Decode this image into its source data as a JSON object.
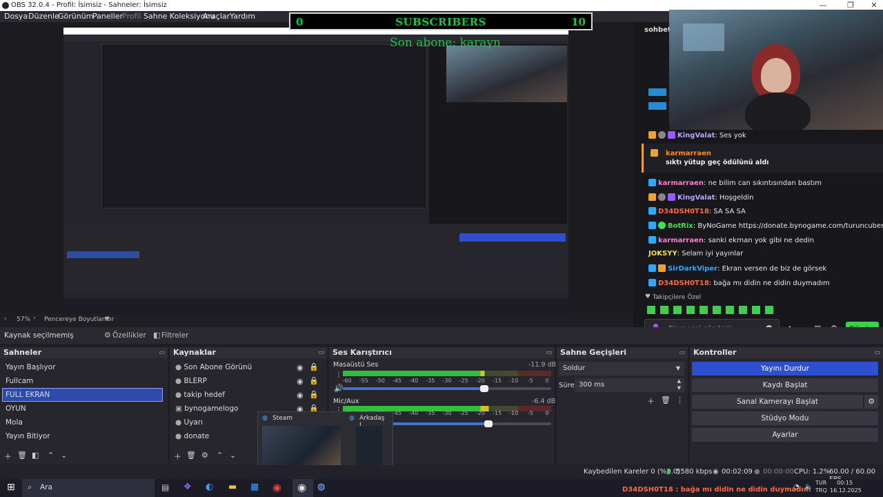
{
  "titlebar": {
    "title": "OBS 32.0.4 - Profil: İsimsiz - Sahneler: İsimsiz",
    "minimize": "—",
    "maximize": "❐",
    "close": "✕"
  },
  "menu": {
    "items": [
      "Dosya",
      "Düzenle",
      "Görünüm",
      "Paneller",
      "Profil",
      "Sahne Koleksiyonu",
      "Araçlar",
      "Yardım"
    ]
  },
  "overlay": {
    "subs_count": "0",
    "subs_title": "SUBSCRIBERS",
    "subs_goal": "10",
    "last_sub": "Son abone: karayn"
  },
  "preview_bar": {
    "zoom": "57%",
    "fit_label": "Pencereye Boyutlandır"
  },
  "source_bar": {
    "status": "Kaynak seçilmemiş",
    "properties": "Özellikler",
    "filters": "Filtreler"
  },
  "scenes": {
    "title": "Sahneler",
    "items": [
      "Yayın Başlıyor",
      "Fullcam",
      "FULL EKRAN",
      "OYUN",
      "Mola",
      "Yayın Bitiyor"
    ],
    "selected_index": 2
  },
  "sources": {
    "title": "Kaynaklar",
    "items": [
      "Son Abone Görünü",
      "BLERP",
      "takip hedef",
      "bynogamelogo",
      "Uyarı",
      "donate"
    ]
  },
  "mixer": {
    "title": "Ses Karıştırıcı",
    "channels": [
      {
        "name": "Masaüstü Ses",
        "db": "-11.9 dB",
        "level": 0.68
      },
      {
        "name": "Mic/Aux",
        "db": "-6.4 dB",
        "level": 0.7
      }
    ],
    "ticks": [
      "-60",
      "-55",
      "-50",
      "-45",
      "-40",
      "-35",
      "-30",
      "-25",
      "-20",
      "-15",
      "-10",
      "-5",
      "0"
    ]
  },
  "transitions": {
    "title": "Sahne Geçişleri",
    "selected": "Soldur",
    "duration_label": "Süre",
    "duration": "300 ms"
  },
  "controls": {
    "title": "Kontroller",
    "buttons": [
      "Yayını Durdur",
      "Kaydı Başlat",
      "Sanal Kamerayı Başlat",
      "Stüdyo Modu",
      "Ayarlar"
    ]
  },
  "chat": {
    "header": "sohbet",
    "messages": [
      {
        "user": "KingValat",
        "text": "Ses yok",
        "color": "#b8a6ff"
      },
      {
        "user": "karmarraen",
        "text": "sıktı yütup geç ödülünü aldı",
        "color": "#ff8c1a"
      },
      {
        "user": "karmarraen",
        "text": "ne bilim can sıkıntısından bastım",
        "color": "#ff7ad4"
      },
      {
        "user": "KingValat",
        "text": "Hoşgeldin",
        "color": "#b8a6ff"
      },
      {
        "user": "D34DSH0T18",
        "text": "SA SA SA",
        "color": "#ff6a3d"
      },
      {
        "user": "BotRix",
        "text": "ByNoGame https://donate.bynogame.com/turuncubenim",
        "color": "#44dd55"
      },
      {
        "user": "karmarraen",
        "text": "sanki ekrnan yok gibi ne dedin",
        "color": "#ff7ad4"
      },
      {
        "user": "JOKSYY",
        "text": "Selam iyi yayınlar",
        "color": "#f0e040"
      },
      {
        "user": "SirDarkViper",
        "text": "Ekran versen de biz de görsek",
        "color": "#2ea8ff"
      },
      {
        "user": "D34DSH0T18",
        "text": "bağa mı didin ne didin duymadım",
        "color": "#ff6a3d"
      }
    ],
    "emote_label": "Takipçilere Özel",
    "input_placeholder": "Bir mesaj gönderin",
    "send": "Gönder"
  },
  "status": {
    "dropped": "Kaybedilen Kareler 0 (%0.0)",
    "bitrate": "5580 kbps",
    "live_time": "00:02:09",
    "rec_time": "00:00:00",
    "cpu": "CPU: 1.2%",
    "fps": "60.00 / 60.00 FPS"
  },
  "taskbar": {
    "search": "Ara",
    "lang1": "TUR",
    "lang2": "TRQ",
    "time": "00:15",
    "date": "16.12.2025",
    "ticker": "D34DSH0T18 : bağa mı didin ne didin duymadım"
  },
  "popup": {
    "app1": "Steam",
    "app2": "Arkadaş L..."
  }
}
